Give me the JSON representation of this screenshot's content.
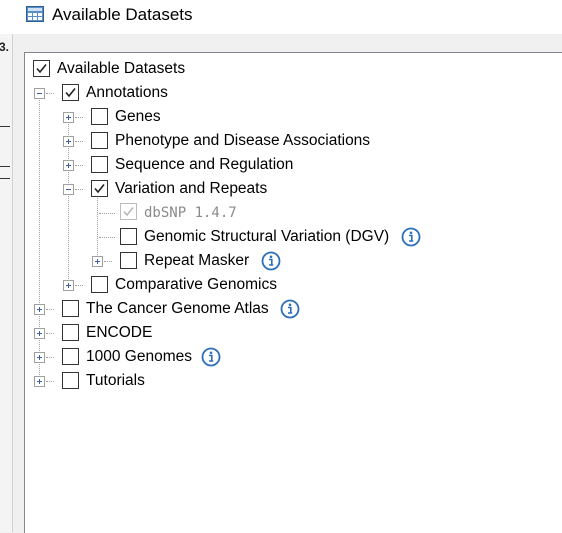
{
  "window": {
    "title": "Available Datasets",
    "app_icon": "app-window-icon"
  },
  "left_strip": {
    "mark": "3."
  },
  "tree": {
    "root": {
      "label": "Available Datasets",
      "checked": true
    },
    "annotations": {
      "label": "Annotations",
      "checked": true,
      "children": {
        "genes": {
          "label": "Genes",
          "checked": false
        },
        "phenotype": {
          "label": "Phenotype and Disease Associations",
          "checked": false
        },
        "sequence": {
          "label": "Sequence and Regulation",
          "checked": false
        },
        "variation": {
          "label": "Variation and Repeats",
          "checked": true,
          "children": {
            "dbsnp": {
              "label": "dbSNP 1.4.7",
              "checked": true,
              "disabled": true
            },
            "dgv": {
              "label": "Genomic Structural Variation (DGV)",
              "checked": false,
              "info_icon": "info-icon"
            },
            "repeat": {
              "label": "Repeat Masker",
              "checked": false,
              "info_icon": "info-icon"
            }
          }
        },
        "comparative": {
          "label": "Comparative Genomics",
          "checked": false
        }
      }
    },
    "tcga": {
      "label": "The Cancer Genome Atlas",
      "checked": false,
      "info_icon": "info-icon"
    },
    "encode": {
      "label": "ENCODE",
      "checked": false
    },
    "genomes1000": {
      "label": "1000 Genomes",
      "checked": false,
      "info_icon": "info-icon"
    },
    "tutorials": {
      "label": "Tutorials",
      "checked": false
    }
  },
  "colors": {
    "info_blue": "#2a6ebb",
    "expander_blue": "#3b5fa8",
    "panel_border": "#828790"
  }
}
